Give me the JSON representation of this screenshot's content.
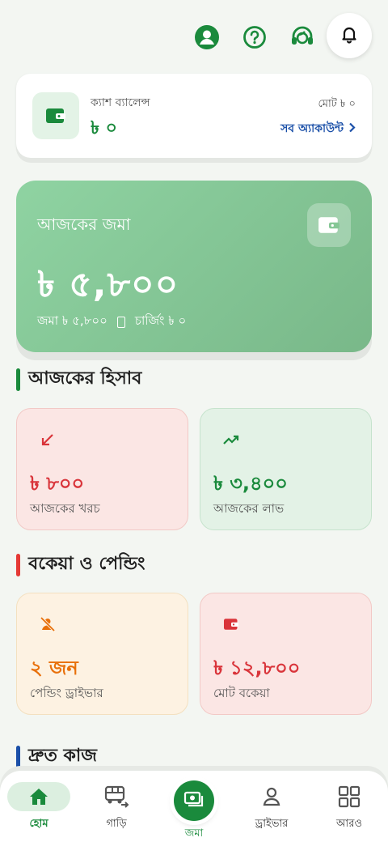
{
  "header": {
    "icons": [
      "profile-icon",
      "help-icon",
      "support-icon",
      "bell-icon"
    ],
    "accent": "#1a8a3c"
  },
  "cash_balance": {
    "label": "ক্যাশ ব্যালেন্স",
    "value": "৳ ০",
    "total_label": "মোট ৳ ০",
    "all_accounts": "সব অ্যাকাউন্ট"
  },
  "today_deposit": {
    "title": "আজকের জমা",
    "amount": "৳ ৫,৮০০",
    "deposit_sub": "জমা ৳ ৫,৮০০",
    "charging_sub": "চার্জিং ৳ ০"
  },
  "today_account": {
    "heading": "আজকের হিসাব",
    "bar_color": "#1a8a3c",
    "expense": {
      "value": "৳ ৮০০",
      "label": "আজকের খরচ",
      "color": "#d9343a"
    },
    "profit": {
      "value": "৳ ৩,৪০০",
      "label": "আজকের লাভ",
      "color": "#1a8a3c"
    }
  },
  "dues": {
    "heading": "বকেয়া ও পেন্ডিং",
    "bar_color": "#e53935",
    "pending": {
      "value": "২ জন",
      "label": "পেন্ডিং ড্রাইভার",
      "color": "#e8700a"
    },
    "total_due": {
      "value": "৳ ১২,৮০০",
      "label": "মোট বকেয়া",
      "color": "#d9343a"
    }
  },
  "quick": {
    "heading": "দ্রুত কাজ",
    "bar_color": "#1a4fa8"
  },
  "nav": {
    "home": "হোম",
    "vehicles": "গাড়ি",
    "deposit": "জমা",
    "drivers": "ড্রাইভার",
    "more": "আরও"
  }
}
